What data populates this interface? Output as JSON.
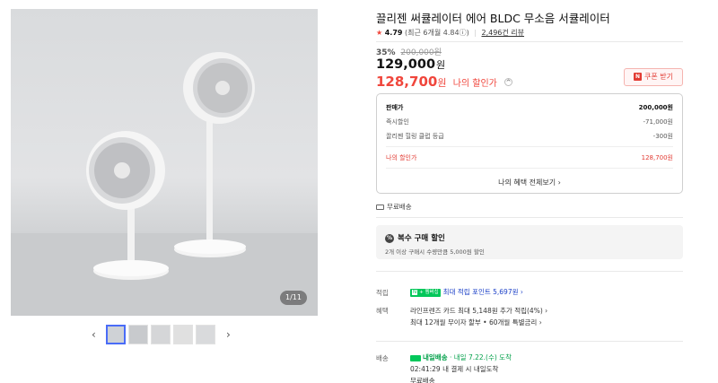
{
  "gallery": {
    "counter": "1/11",
    "prev_arrow": "‹",
    "next_arrow": "›"
  },
  "product": {
    "title": "끌리젠 써큘레이터 에어 BLDC 무소음 서큘레이터",
    "rating_star": "★",
    "rating_score": "4.79",
    "rating_recent": "(최근 6개월 4.84ⓘ)",
    "review_count": "2,496건 리뷰"
  },
  "pricing": {
    "discount_rate": "35%",
    "original_price": "200,000원",
    "price": "129,000",
    "price_unit": "원",
    "my_price": "128,700",
    "my_price_unit": "원",
    "my_price_label": "나의 할인가",
    "toggle_icon": "^",
    "coupon_badge": "N",
    "coupon_label": "쿠폰 받기"
  },
  "price_box": {
    "rows": [
      {
        "label": "판매가",
        "value": "200,000원"
      },
      {
        "label": "즉시할인",
        "value": "-71,000원"
      },
      {
        "label": "끌리젠 힐링 클럽 등급",
        "value": "-300원"
      }
    ],
    "final_label": "나의 할인가",
    "final_value": "128,700원",
    "more_link": "나의 혜택 전체보기 ›"
  },
  "delivery": {
    "label": "무료배송"
  },
  "multi_purchase": {
    "icon": "%",
    "title": "복수 구매 할인",
    "desc": "2개 이상 구매시 수량만큼 5,000원 할인"
  },
  "points": {
    "label": "적립",
    "badge_n": "N",
    "badge_text": "+ 멤버십",
    "value": "최대 적립 포인트 5,697원 ›"
  },
  "benefits": {
    "label": "혜택",
    "line1": "라인프렌즈 카드 최대 5,148원 추가 적립(4%) ›",
    "line2": "최대 12개월 무이자 할부 • 60개월 특별금리 ›"
  },
  "shipping": {
    "label": "배송",
    "tomorrow": "내일배송",
    "tomorrow_date": "· 내일 7.22.(수) 도착",
    "line2": "02:41:29  내 결제 시 내일도착",
    "line3": "무료배송"
  }
}
